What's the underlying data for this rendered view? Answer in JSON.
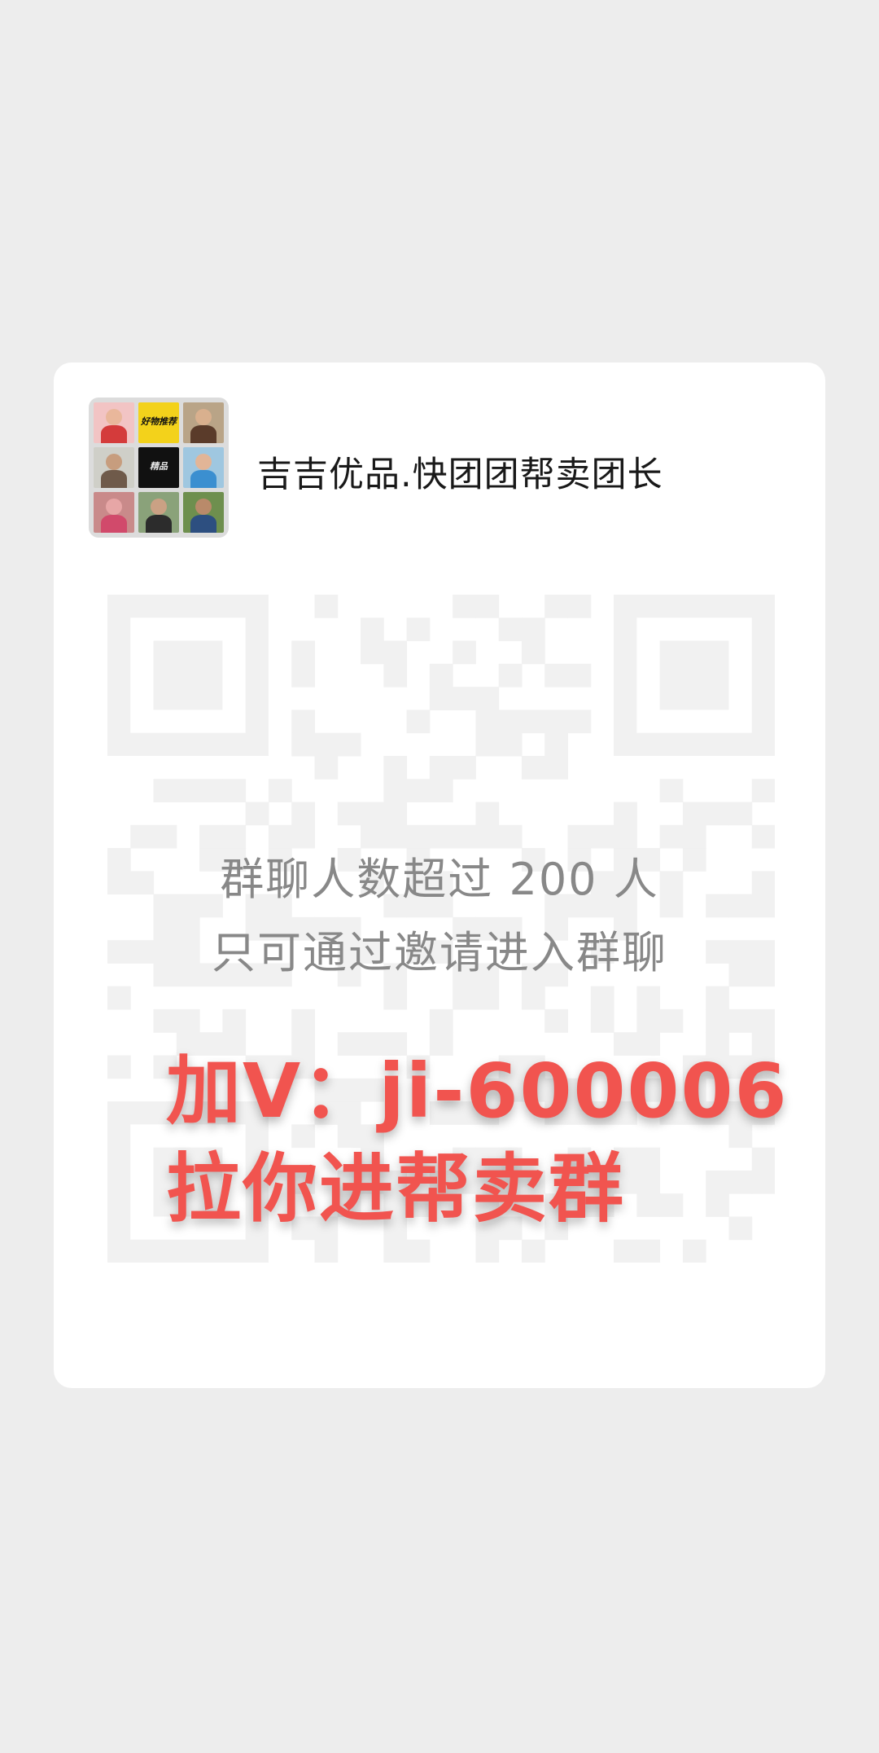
{
  "group": {
    "name": "吉吉优品.快团团帮卖团长",
    "avatar_label": "group-avatar-collage"
  },
  "notice": {
    "line1": "群聊人数超过 200 人",
    "line2": "只可通过邀请进入群聊"
  },
  "promo": {
    "line1": "加V：ji-600006",
    "line2": "拉你进帮卖群"
  },
  "avatar_tiles": [
    {
      "bg": "#f2c4c4",
      "face": "#e9b79b",
      "body": "#d43b3b"
    },
    {
      "bg": "#f3d21b",
      "brand": "好物推荐"
    },
    {
      "bg": "#b9a487",
      "face": "#d9b08e",
      "body": "#5a3b2a"
    },
    {
      "bg": "#cfcfc8",
      "face": "#c79d7e",
      "body": "#6f5a4a"
    },
    {
      "bg": "#111111",
      "brand": "精品"
    },
    {
      "bg": "#9fc7e0",
      "face": "#e2b597",
      "body": "#3b8fd0"
    },
    {
      "bg": "#c98a8a",
      "face": "#e7a6a6",
      "body": "#d14a6b"
    },
    {
      "bg": "#8aa27a",
      "face": "#caa184",
      "body": "#2c2c2c"
    },
    {
      "bg": "#6e8f4e",
      "face": "#b98a6a",
      "body": "#2d4f80"
    }
  ],
  "colors": {
    "background": "#ededed",
    "card": "#ffffff",
    "promo_text": "#f1544f",
    "notice_text": "#888888"
  }
}
